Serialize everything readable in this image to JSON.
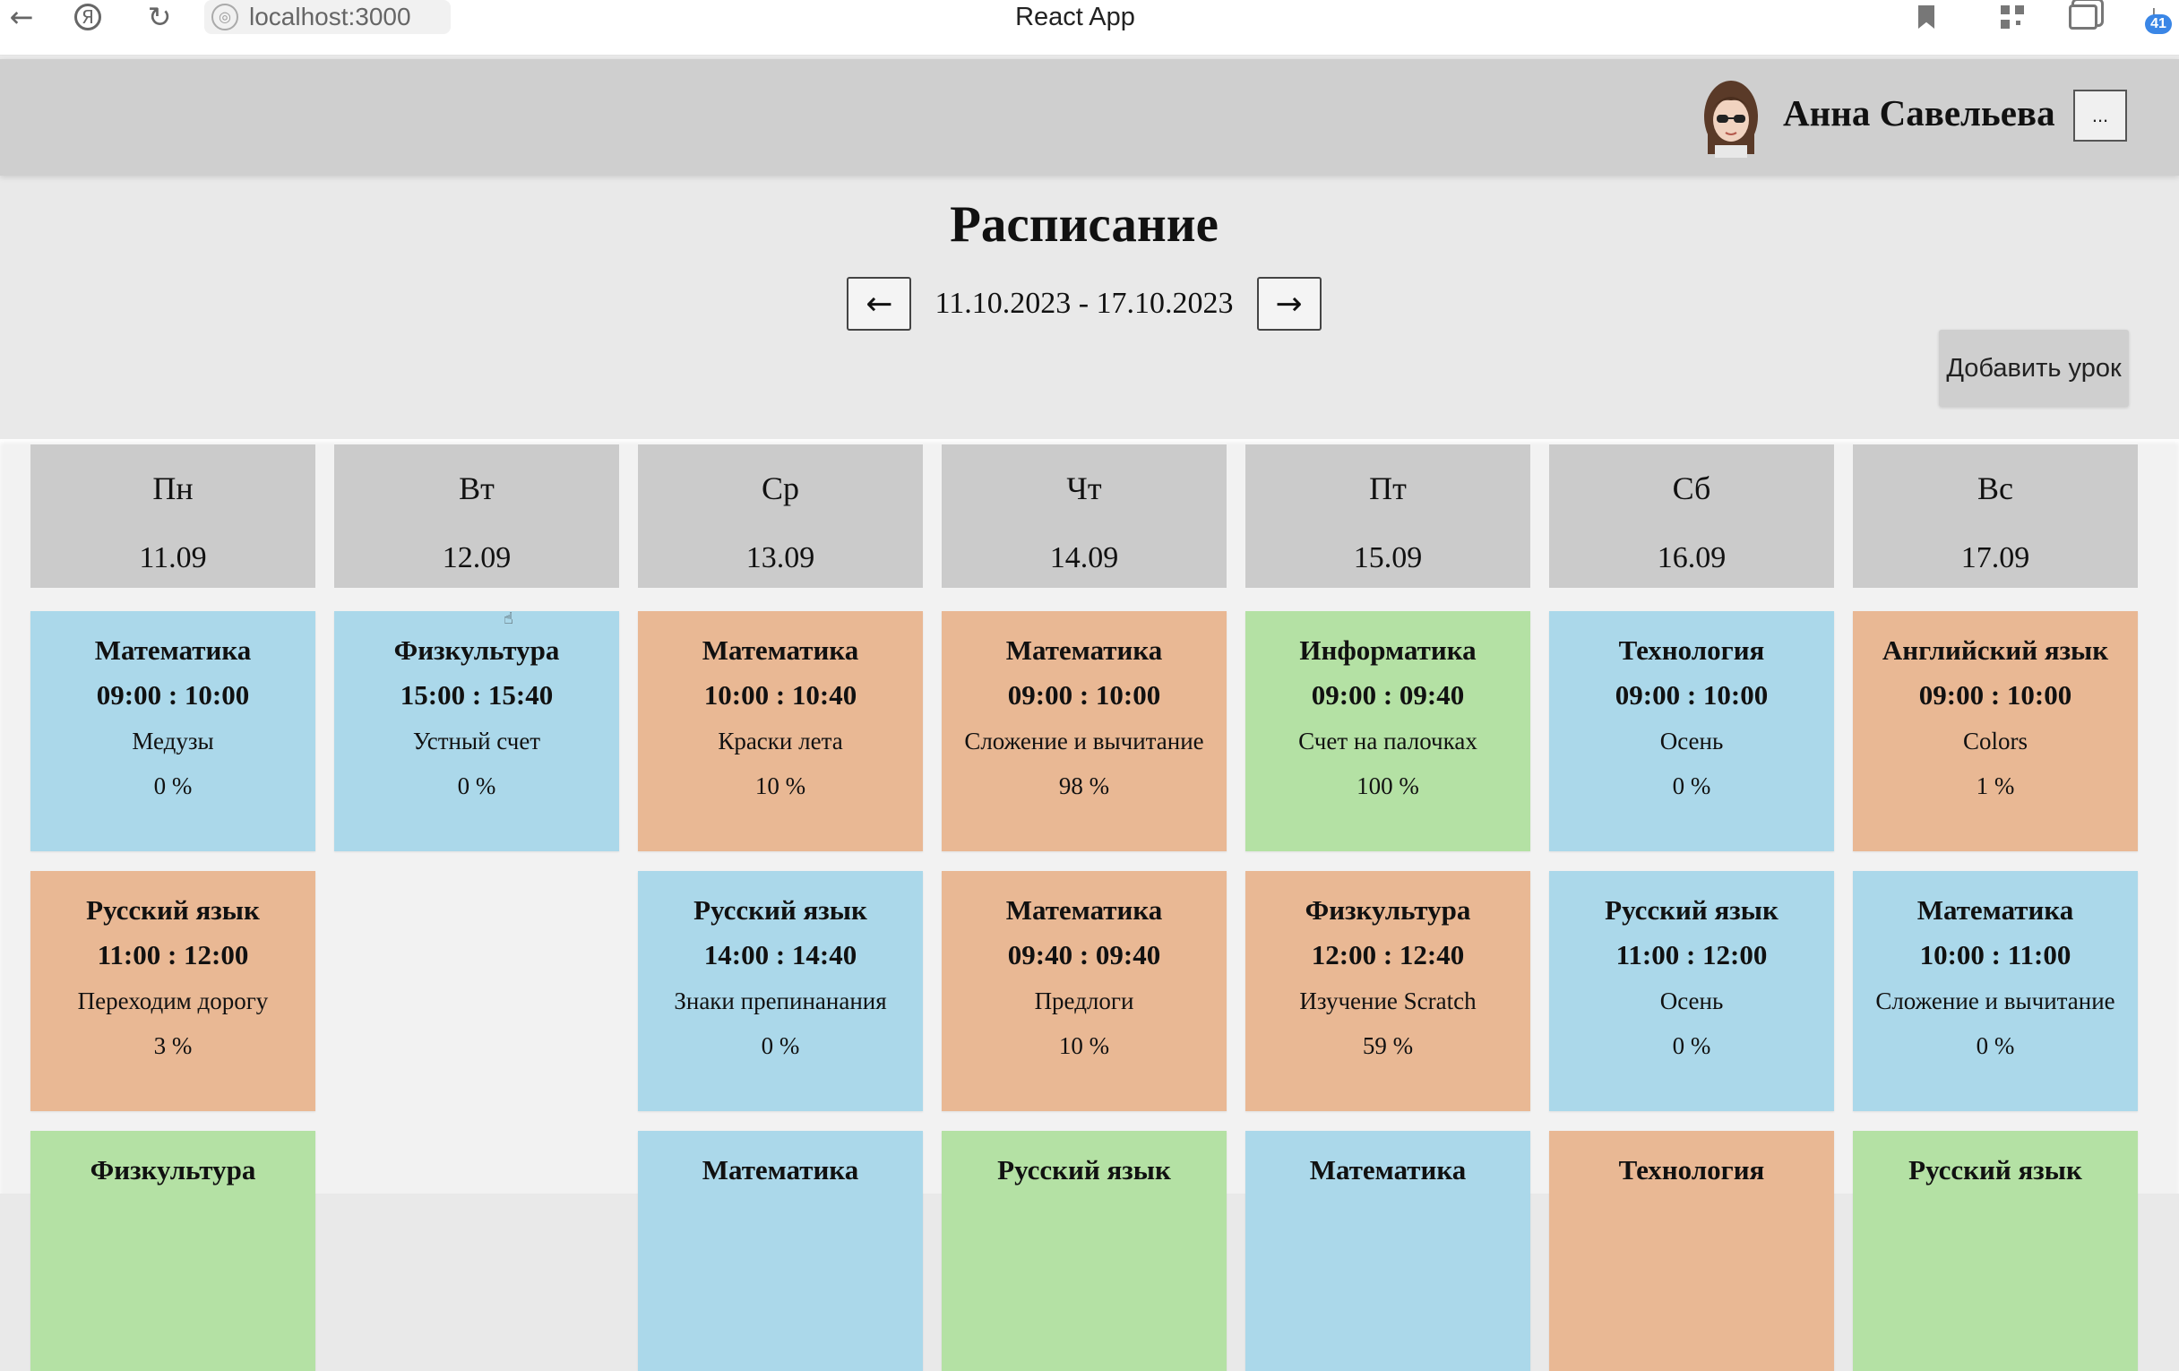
{
  "browser": {
    "url": "localhost:3000",
    "tab_title": "React App",
    "download_badge": "41"
  },
  "header": {
    "user_name": "Анна Савельева",
    "menu_label": "..."
  },
  "schedule": {
    "title": "Расписание",
    "prev_label": "←",
    "next_label": "→",
    "date_range": "11.10.2023 - 17.10.2023",
    "add_lesson_label": "Добавить урок"
  },
  "colors": {
    "blue": "#abd8ea",
    "orange": "#e9b894",
    "green": "#b4e1a4"
  },
  "days": [
    {
      "name": "Пн",
      "date": "11.09",
      "lessons": [
        {
          "subject": "Математика",
          "time": "09:00 : 10:00",
          "topic": "Медузы",
          "progress": "0 %",
          "color": "blue"
        },
        {
          "subject": "Русский язык",
          "time": "11:00 : 12:00",
          "topic": "Переходим дорогу",
          "progress": "3 %",
          "color": "orange"
        },
        {
          "subject": "Физкультура",
          "time": "",
          "topic": "",
          "progress": "",
          "color": "green"
        }
      ]
    },
    {
      "name": "Вт",
      "date": "12.09",
      "lessons": [
        {
          "subject": "Физкультура",
          "time": "15:00 : 15:40",
          "topic": "Устный счет",
          "progress": "0 %",
          "color": "blue"
        }
      ]
    },
    {
      "name": "Ср",
      "date": "13.09",
      "lessons": [
        {
          "subject": "Математика",
          "time": "10:00 : 10:40",
          "topic": "Краски лета",
          "progress": "10 %",
          "color": "orange"
        },
        {
          "subject": "Русский язык",
          "time": "14:00 : 14:40",
          "topic": "Знаки препинанания",
          "progress": "0 %",
          "color": "blue"
        },
        {
          "subject": "Математика",
          "time": "",
          "topic": "",
          "progress": "",
          "color": "blue"
        }
      ]
    },
    {
      "name": "Чт",
      "date": "14.09",
      "lessons": [
        {
          "subject": "Математика",
          "time": "09:00 : 10:00",
          "topic": "Сложение и вычитание",
          "progress": "98 %",
          "color": "orange"
        },
        {
          "subject": "Математика",
          "time": "09:40 : 09:40",
          "topic": "Предлоги",
          "progress": "10 %",
          "color": "orange"
        },
        {
          "subject": "Русский язык",
          "time": "",
          "topic": "",
          "progress": "",
          "color": "green"
        }
      ]
    },
    {
      "name": "Пт",
      "date": "15.09",
      "lessons": [
        {
          "subject": "Информатика",
          "time": "09:00 : 09:40",
          "topic": "Счет на палочках",
          "progress": "100 %",
          "color": "green"
        },
        {
          "subject": "Физкультура",
          "time": "12:00 : 12:40",
          "topic": "Изучение Scratch",
          "progress": "59 %",
          "color": "orange"
        },
        {
          "subject": "Математика",
          "time": "",
          "topic": "",
          "progress": "",
          "color": "blue"
        }
      ]
    },
    {
      "name": "Сб",
      "date": "16.09",
      "lessons": [
        {
          "subject": "Технология",
          "time": "09:00 : 10:00",
          "topic": "Осень",
          "progress": "0 %",
          "color": "blue"
        },
        {
          "subject": "Русский язык",
          "time": "11:00 : 12:00",
          "topic": "Осень",
          "progress": "0 %",
          "color": "blue"
        },
        {
          "subject": "Технология",
          "time": "",
          "topic": "",
          "progress": "",
          "color": "orange"
        }
      ]
    },
    {
      "name": "Вс",
      "date": "17.09",
      "lessons": [
        {
          "subject": "Английский язык",
          "time": "09:00 : 10:00",
          "topic": "Colors",
          "progress": "1 %",
          "color": "orange"
        },
        {
          "subject": "Математика",
          "time": "10:00 : 11:00",
          "topic": "Сложение и вычитание",
          "progress": "0 %",
          "color": "blue"
        },
        {
          "subject": "Русский язык",
          "time": "",
          "topic": "",
          "progress": "",
          "color": "green"
        }
      ]
    }
  ]
}
